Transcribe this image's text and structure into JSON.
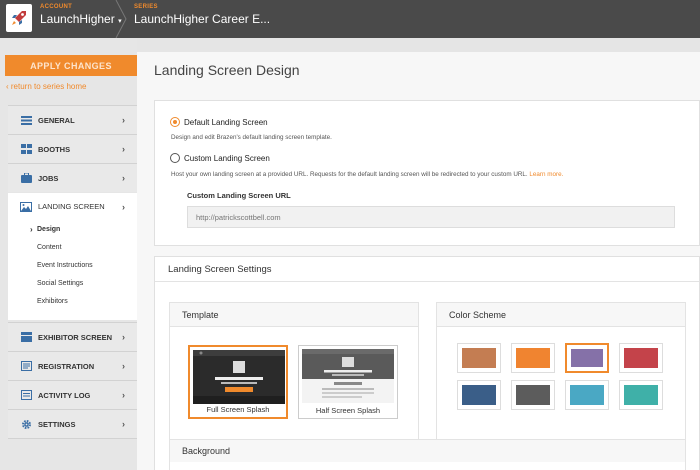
{
  "topbar": {
    "account_label": "ACCOUNT",
    "account_name": "LaunchHigher",
    "series_label": "SERIES",
    "series_name": "LaunchHigher Career E..."
  },
  "sidebar": {
    "apply_label": "APPLY CHANGES",
    "return_label": "return to series home",
    "items": [
      {
        "label": "GENERAL",
        "icon": "general-icon"
      },
      {
        "label": "BOOTHS",
        "icon": "booths-icon"
      },
      {
        "label": "JOBS",
        "icon": "jobs-icon"
      },
      {
        "label": "LANDING SCREEN",
        "icon": "landing-screen-icon"
      },
      {
        "label": "EXHIBITOR SCREEN",
        "icon": "exhibitor-icon"
      },
      {
        "label": "REGISTRATION",
        "icon": "registration-icon"
      },
      {
        "label": "ACTIVITY LOG",
        "icon": "activity-log-icon"
      },
      {
        "label": "SETTINGS",
        "icon": "gear-icon"
      }
    ],
    "subitems": [
      "Design",
      "Content",
      "Event Instructions",
      "Social Settings",
      "Exhibitors"
    ]
  },
  "main": {
    "title": "Landing Screen Design",
    "default_option": {
      "label": "Default Landing Screen",
      "desc": "Design and edit Brazen's default landing screen template.",
      "selected": true
    },
    "custom_option": {
      "label": "Custom Landing Screen",
      "desc": "Host your own landing screen at a provided URL. Requests for the default landing screen will be redirected to your custom URL.",
      "learn_more": "Learn more.",
      "selected": false
    },
    "custom_url": {
      "label": "Custom Landing Screen URL",
      "placeholder": "http://patrickscottbell.com"
    },
    "settings": {
      "heading": "Landing Screen Settings",
      "template_heading": "Template",
      "templates": [
        {
          "label": "Full Screen Splash",
          "selected": true
        },
        {
          "label": "Half Screen Splash",
          "selected": false
        }
      ],
      "color_heading": "Color Scheme",
      "colors": [
        "#c47d52",
        "#f08430",
        "#8571a8",
        "#c4434a",
        "#3a5e88",
        "#5c5c5c",
        "#4aa8c4",
        "#3fb0a8"
      ],
      "selected_color_index": 2,
      "background_heading": "Background"
    }
  },
  "colors": {
    "accent": "#f08a2c",
    "topbar": "#4a4a4a"
  }
}
